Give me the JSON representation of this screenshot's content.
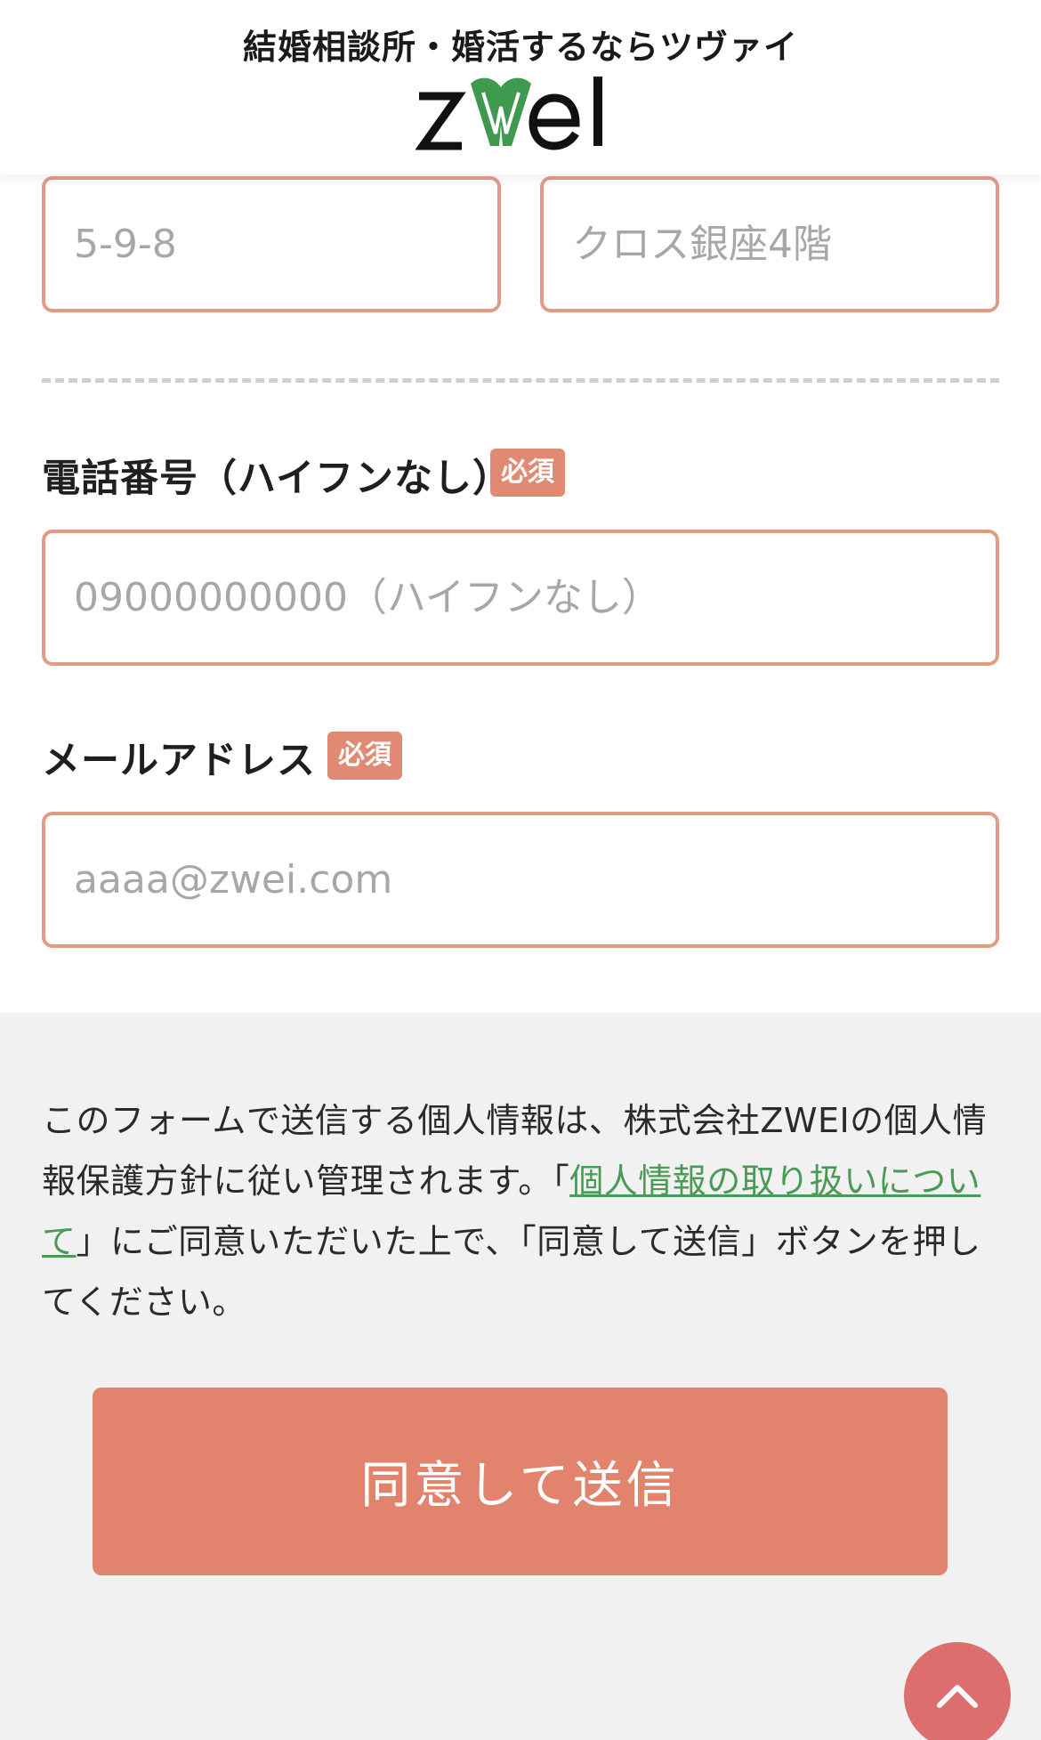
{
  "header": {
    "tagline": "結婚相談所・婚活するならツヴァイ",
    "logo_text": "ZWEI"
  },
  "address": {
    "street_placeholder": "5-9-8",
    "building_placeholder": "クロス銀座4階"
  },
  "phone": {
    "label": "電話番号（ハイフンなし）",
    "required_badge": "必須",
    "placeholder": "09000000000（ハイフンなし）"
  },
  "email": {
    "label": "メールアドレス",
    "required_badge": "必須",
    "placeholder": "aaaa@zwei.com"
  },
  "consent": {
    "text_before": "このフォームで送信する個人情報は、株式会社ZWEIの個人情報保護方針に従い管理されます。「",
    "link_text": "個人情報の取り扱いについて",
    "text_after": "」にご同意いただいた上で、「同意して送信」ボタンを押してください。"
  },
  "submit": {
    "label": "同意して送信"
  },
  "colors": {
    "accent": "#e2846d",
    "field_border": "#e19c86",
    "link": "#4a9a55",
    "logo_heart": "#3f9a4f",
    "scroll_top": "#dc6e6e",
    "section_bg": "#f1f1f1"
  },
  "icons": {
    "logo": "zwei-heart-logo",
    "scroll_top": "chevron-up-icon"
  }
}
